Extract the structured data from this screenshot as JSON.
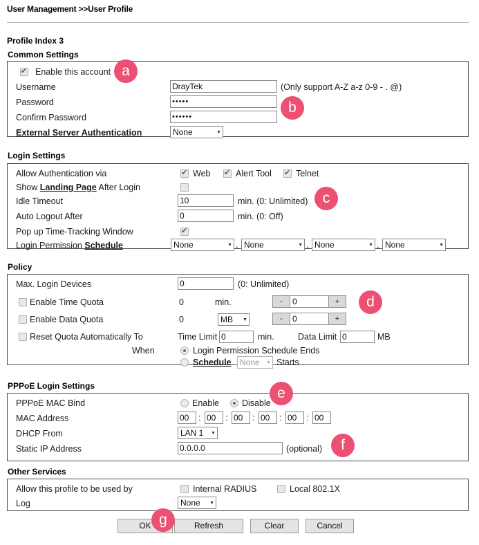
{
  "breadcrumb": "User Management >>User Profile",
  "profile_index": "Profile Index 3",
  "sections": {
    "common": {
      "title": "Common Settings",
      "enable_account_label": "Enable this account",
      "username_label": "Username",
      "username_value": "DrayTek",
      "username_hint": "(Only support A-Z a-z 0-9 - . @)",
      "password_label": "Password",
      "password_value": "•••••",
      "confirm_password_label": "Confirm Password",
      "confirm_password_value": "••••••",
      "external_auth_label": "External Server Authentication",
      "external_auth_value": "None"
    },
    "login": {
      "title": "Login Settings",
      "allow_auth_label": "Allow Authentication via",
      "auth_web": "Web",
      "auth_alert_tool": "Alert Tool",
      "auth_telnet": "Telnet",
      "landing_prefix": "Show ",
      "landing_link": "Landing Page",
      "landing_suffix": " After Login",
      "idle_timeout_label": "Idle Timeout",
      "idle_timeout_value": "10",
      "idle_timeout_hint": "min. (0: Unlimited)",
      "auto_logout_label": "Auto Logout After",
      "auto_logout_value": "0",
      "auto_logout_hint": "min. (0: Off)",
      "popup_label": "Pop up Time-Tracking Window",
      "permission_label": "Login Permission ",
      "permission_link": "Schedule",
      "schedules": [
        "None",
        "None",
        "None",
        "None"
      ],
      "separator": ","
    },
    "policy": {
      "title": "Policy",
      "max_login_label": "Max. Login Devices",
      "max_login_value": "0",
      "max_login_hint": "(0: Unlimited)",
      "time_quota_label": "Enable Time Quota",
      "time_quota_current": "0",
      "time_quota_unit": "min.",
      "time_quota_spin": "0",
      "data_quota_label": "Enable Data Quota",
      "data_quota_current": "0",
      "data_quota_unit": "MB",
      "data_quota_spin": "0",
      "reset_label": "Reset Quota Automatically To",
      "time_limit_label": "Time Limit",
      "time_limit_value": "0",
      "time_limit_unit": "min.",
      "data_limit_label": "Data Limit",
      "data_limit_value": "0",
      "data_limit_unit": "MB",
      "when_label": "When",
      "when_opt1": "Login Permission Schedule Ends",
      "when_opt2_link": "Schedule",
      "when_opt2_select": "None",
      "when_opt2_suffix": "Starts",
      "minus": "-",
      "plus": "+"
    },
    "pppoe": {
      "title": "PPPoE Login Settings",
      "mac_bind_label": "PPPoE MAC Bind",
      "enable_label": "Enable",
      "disable_label": "Disable",
      "mac_address_label": "MAC Address",
      "mac_octets": [
        "00",
        "00",
        "00",
        "00",
        "00",
        "00"
      ],
      "mac_sep": ":",
      "dhcp_from_label": "DHCP From",
      "dhcp_from_value": "LAN 1",
      "static_ip_label": "Static IP Address",
      "static_ip_value": "0.0.0.0",
      "static_ip_hint": "(optional)"
    },
    "other": {
      "title": "Other Services",
      "allow_profile_label": "Allow this profile to be used by",
      "internal_radius": "Internal RADIUS",
      "local_8021x": "Local 802.1X",
      "log_label": "Log",
      "log_value": "None"
    }
  },
  "buttons": {
    "ok": "OK",
    "refresh": "Refresh",
    "clear": "Clear",
    "cancel": "Cancel"
  },
  "markers": [
    {
      "letter": "a"
    },
    {
      "letter": "b"
    },
    {
      "letter": "c"
    },
    {
      "letter": "d"
    },
    {
      "letter": "e"
    },
    {
      "letter": "f"
    },
    {
      "letter": "g"
    }
  ],
  "colors": {
    "marker": "#ec5073",
    "border": "#4a4a4a"
  }
}
